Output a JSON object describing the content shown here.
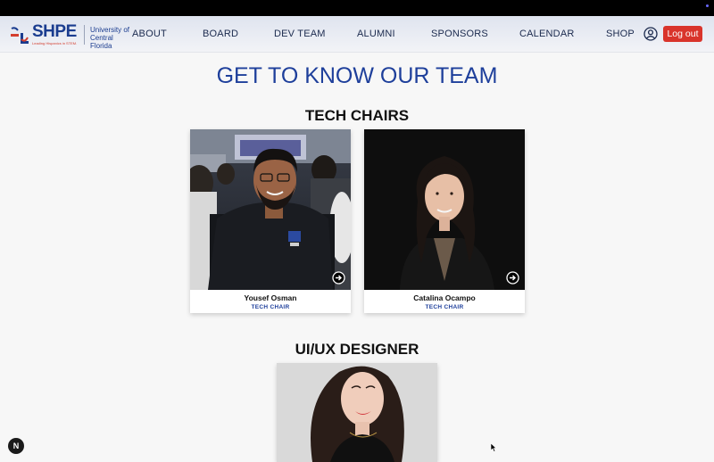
{
  "brand": {
    "logo_text": "SHPE",
    "tagline": "Leading Hispanics in STEM.",
    "university": "University of Central Florida"
  },
  "nav": {
    "items": [
      "ABOUT",
      "BOARD",
      "DEV TEAM",
      "ALUMNI",
      "SPONSORS",
      "CALENDAR",
      "SHOP"
    ],
    "logout_label": "Log out"
  },
  "page": {
    "title": "GET TO KNOW OUR TEAM"
  },
  "sections": [
    {
      "title": "TECH CHAIRS",
      "members": [
        {
          "name": "Yousef Osman",
          "role": "TECH CHAIR"
        },
        {
          "name": "Catalina Ocampo",
          "role": "TECH CHAIR"
        }
      ]
    },
    {
      "title": "UI/UX DESIGNER",
      "members": [
        {
          "name": "",
          "role": ""
        }
      ]
    }
  ],
  "dev_badge": "N",
  "colors": {
    "brand_blue": "#1e3f9b",
    "logout_red": "#d9342b",
    "top_bar": "#000000"
  }
}
